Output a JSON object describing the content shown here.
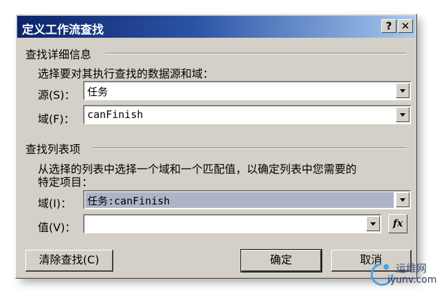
{
  "window": {
    "title": "定义工作流查找",
    "help_label": "?",
    "close_label": "✕"
  },
  "details": {
    "section_title": "查找详细信息",
    "instruction": "选择要对其执行查找的数据源和域：",
    "source_label": "源(S)：",
    "source_value": "任务",
    "field_label": "域(F)：",
    "field_value": "canFinish"
  },
  "list": {
    "section_title": "查找列表项",
    "instruction_line1": "从选择的列表中选择一个域和一个匹配值，以确定列表中您需要的",
    "instruction_line2": "特定项目：",
    "field_label": "域(I)：",
    "field_value": "任务:canFinish",
    "value_label": "值(V)：",
    "value_value": "",
    "fx_label": "fx"
  },
  "buttons": {
    "clear_label": "清除查找(C)",
    "ok_label": "确定",
    "cancel_label": "取消"
  },
  "watermark": {
    "text": "运维网",
    "url": "iyunv.com"
  }
}
